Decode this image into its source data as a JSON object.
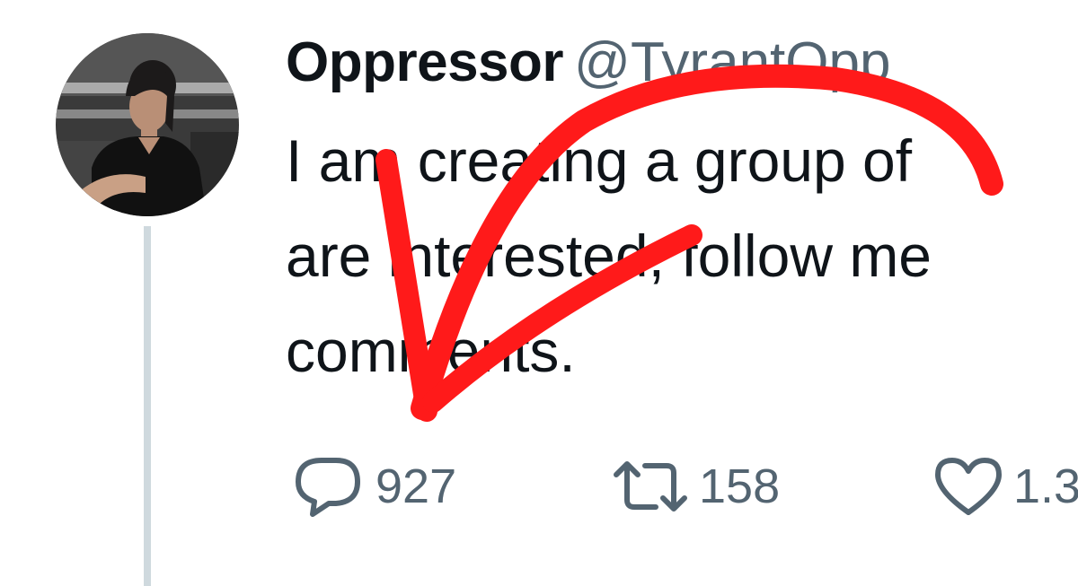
{
  "tweet": {
    "author": {
      "name": "Oppressor",
      "handle": "@TyrantOpp"
    },
    "text_lines": [
      "I am creating a group of",
      "are interested, follow me",
      "comments."
    ],
    "actions": {
      "reply": {
        "icon": "speech-bubble-icon",
        "count": "927"
      },
      "retweet": {
        "icon": "retweet-arrows-icon",
        "count": "158"
      },
      "like": {
        "icon": "heart-icon",
        "count": "1.3"
      }
    }
  },
  "annotation": {
    "icon": "red-arrow-annotation",
    "color": "#ff0000"
  },
  "colors": {
    "text_primary": "#0f1419",
    "text_secondary": "#536471",
    "thread_line": "#cfd9de"
  }
}
